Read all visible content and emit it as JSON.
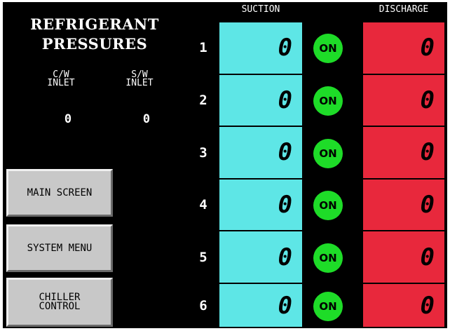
{
  "title": {
    "line1": "REFRIGERANT",
    "line2": "PRESSURES"
  },
  "inlets": [
    {
      "label": "C/W\nINLET",
      "value": "0"
    },
    {
      "label": "S/W\nINLET",
      "value": "0"
    }
  ],
  "nav": {
    "main_screen": "MAIN SCREEN",
    "system_menu": "SYSTEM MENU",
    "chiller_control": "CHILLER\nCONTROL"
  },
  "columns": {
    "suction": "SUCTION",
    "discharge": "DISCHARGE"
  },
  "compressors": [
    {
      "num": "1",
      "suction": "0",
      "status": "ON",
      "discharge": "0"
    },
    {
      "num": "2",
      "suction": "0",
      "status": "ON",
      "discharge": "0"
    },
    {
      "num": "3",
      "suction": "0",
      "status": "ON",
      "discharge": "0"
    },
    {
      "num": "4",
      "suction": "0",
      "status": "ON",
      "discharge": "0"
    },
    {
      "num": "5",
      "suction": "0",
      "status": "ON",
      "discharge": "0"
    },
    {
      "num": "6",
      "suction": "0",
      "status": "ON",
      "discharge": "0"
    }
  ],
  "colors": {
    "suction": "#5ee6e6",
    "discharge": "#e8283c",
    "on": "#1edc28",
    "background": "#000000"
  }
}
